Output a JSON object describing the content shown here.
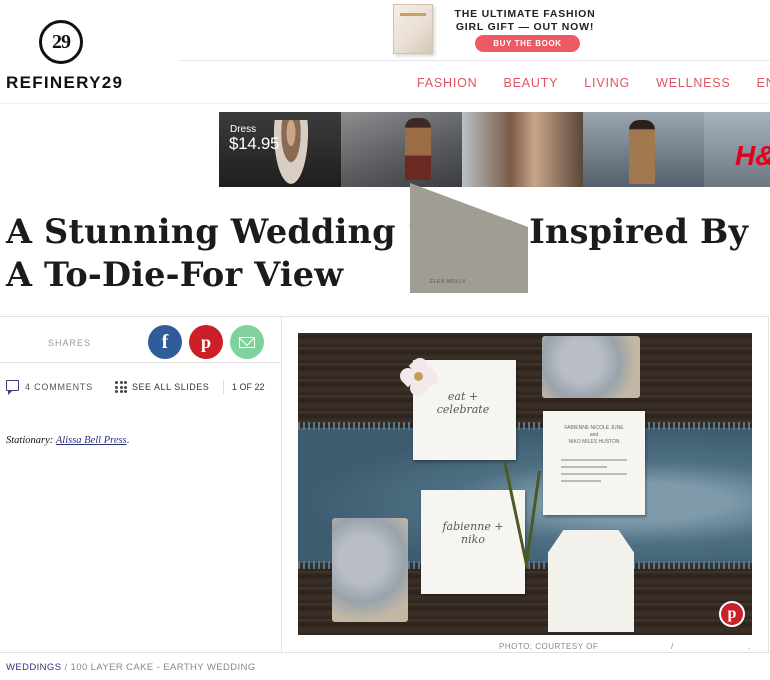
{
  "brand": {
    "logo_mark": "29",
    "logo_word": "REFINERY29"
  },
  "promo": {
    "line1": "THE ULTIMATE FASHION",
    "line2": "GIRL GIFT — OUT NOW!",
    "button": "BUY THE BOOK"
  },
  "nav": {
    "items": [
      "FASHION",
      "BEAUTY",
      "LIVING",
      "WELLNESS",
      "ENTER"
    ]
  },
  "ad": {
    "price_label": "Dress",
    "price": "$14.95",
    "brand": "H&"
  },
  "article": {
    "headline": "A Stunning Wedding Shoot Inspired By A To-Die-For View",
    "shares_label": "SHARES",
    "comments": "4 COMMENTS",
    "see_all": "SEE ALL SLIDES",
    "slide_count": "1 OF 22",
    "credit_label": "Stationary:",
    "credit_link": "Alissa Bell Press",
    "credit_end": ".",
    "photo_credit": "PHOTO: COURTESY OF",
    "photo_credit_sep": "/",
    "photo_credit_end": "."
  },
  "photo": {
    "card1_script": "eat + celebrate",
    "card2_title_a": "FABIENNE NICOLE JUNE",
    "card2_and": "and",
    "card2_title_b": "NIKO MILES HUSTON",
    "card3_script": "fabienne + niko",
    "envelope_text": "ELEN MOLLY"
  },
  "breadcrumb": {
    "active": "WEDDINGS",
    "rest": " / 100 LAYER CAKE - EARTHY WEDDING"
  },
  "colors": {
    "accent": "#e0545f",
    "facebook": "#305c99",
    "pinterest": "#cb2027",
    "email": "#7fd29b",
    "link": "#2a2f78"
  }
}
